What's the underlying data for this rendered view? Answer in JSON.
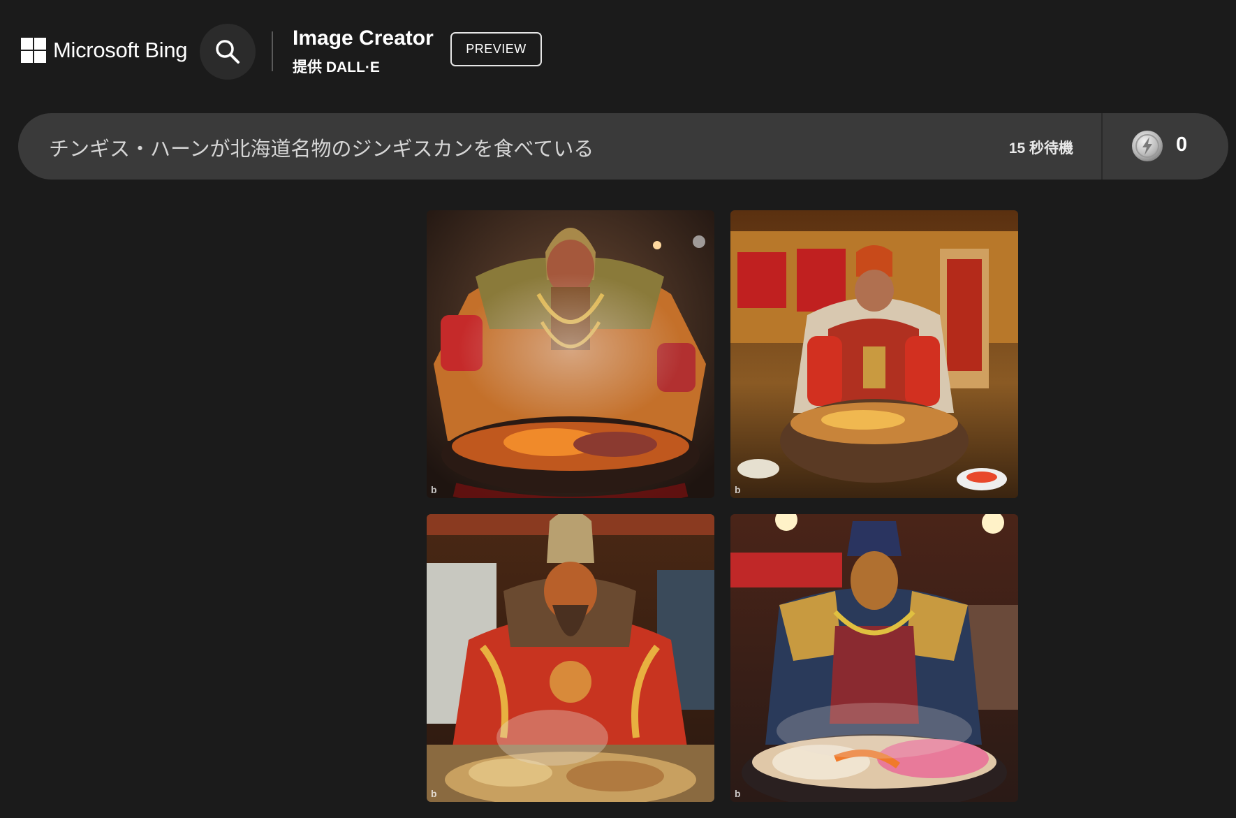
{
  "header": {
    "brand": "Microsoft Bing",
    "product_title": "Image Creator",
    "product_subtitle": "提供 DALL·E",
    "badge": "PREVIEW"
  },
  "prompt_bar": {
    "prompt": "チンギス・ハーンが北海道名物のジンギスカンを食べている",
    "wait_status": "15 秒待機",
    "boost_count": "0"
  },
  "icons": {
    "search": "search-icon",
    "boost": "boost-coin-icon",
    "logo": "microsoft-logo-icon"
  },
  "results": [
    {
      "watermark": "b"
    },
    {
      "watermark": "b"
    },
    {
      "watermark": "b"
    },
    {
      "watermark": "b"
    }
  ],
  "colors": {
    "page_background": "#1b1b1b",
    "prompt_bar": "#3a3a3a",
    "search_button": "#2b2b2b"
  }
}
